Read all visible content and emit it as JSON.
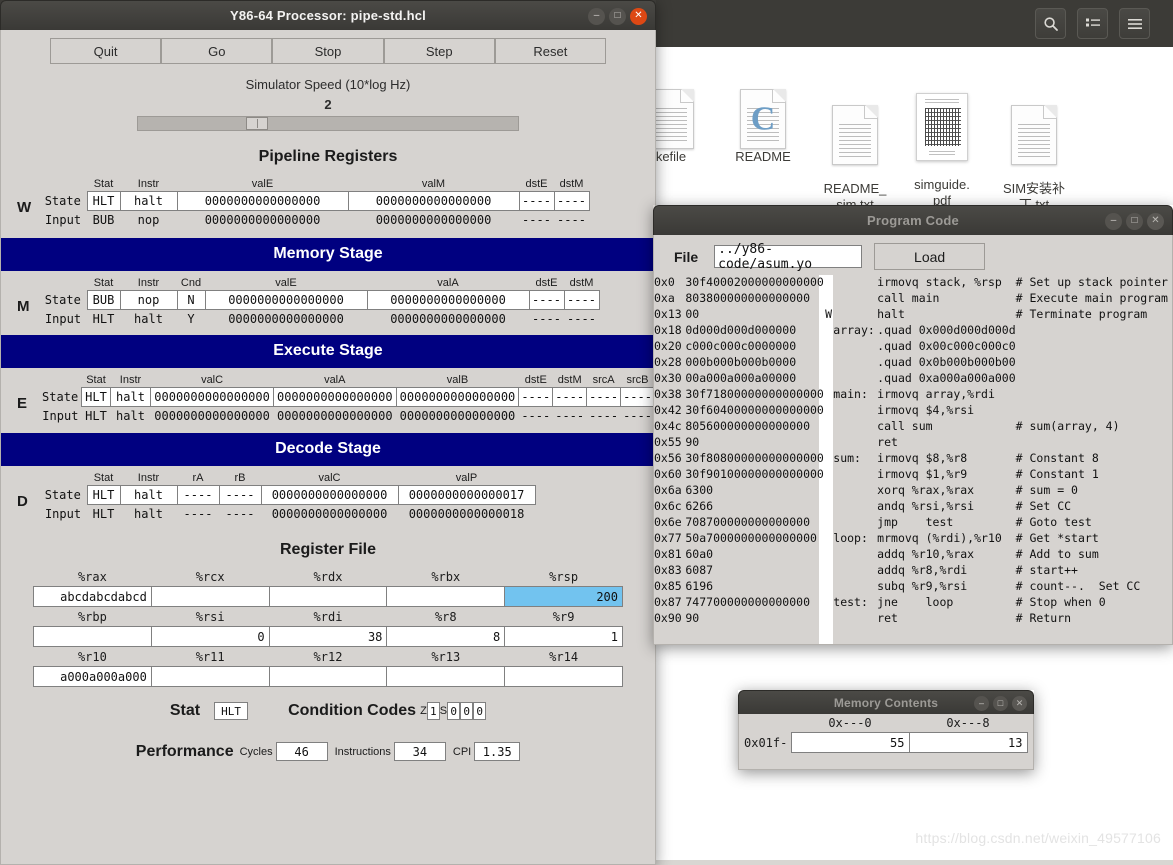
{
  "desktop": {
    "toolbar_icons": [
      "search-icon",
      "list-view-icon",
      "menu-icon"
    ],
    "files": [
      {
        "name": "kefile",
        "icon": "document-icon"
      },
      {
        "name": "README",
        "icon": "c-source-icon"
      },
      {
        "name": "README_\nsim.txt",
        "icon": "document-icon"
      },
      {
        "name": "simguide.\npdf",
        "icon": "pdf-icon"
      },
      {
        "name": "SIM安装补\n丁.txt",
        "icon": "document-icon"
      }
    ],
    "watermark": "https://blog.csdn.net/weixin_49577106"
  },
  "sim": {
    "title": "Y86-64 Processor: pipe-std.hcl",
    "buttons": [
      "Quit",
      "Go",
      "Stop",
      "Step",
      "Reset"
    ],
    "speed_label": "Simulator Speed (10*log Hz)",
    "speed_value": "2",
    "pipeline_title": "Pipeline Registers",
    "W": {
      "letter": "W",
      "headers": [
        "Stat",
        "Instr",
        "valE",
        "valM",
        "dstE",
        "dstM"
      ],
      "state_label": "State",
      "input_label": "Input",
      "state": [
        "HLT",
        "halt",
        "0000000000000000",
        "0000000000000000",
        "----",
        "----"
      ],
      "input": [
        "BUB",
        "nop",
        "0000000000000000",
        "0000000000000000",
        "----",
        "----"
      ]
    },
    "M": {
      "banner": "Memory Stage",
      "letter": "M",
      "headers": [
        "Stat",
        "Instr",
        "Cnd",
        "valE",
        "valA",
        "dstE",
        "dstM"
      ],
      "state_label": "State",
      "input_label": "Input",
      "state": [
        "BUB",
        "nop",
        "N",
        "0000000000000000",
        "0000000000000000",
        "----",
        "----"
      ],
      "input": [
        "HLT",
        "halt",
        "Y",
        "0000000000000000",
        "0000000000000000",
        "----",
        "----"
      ]
    },
    "E": {
      "banner": "Execute Stage",
      "letter": "E",
      "headers": [
        "Stat",
        "Instr",
        "valC",
        "valA",
        "valB",
        "dstE",
        "dstM",
        "srcA",
        "srcB"
      ],
      "state_label": "State",
      "input_label": "Input",
      "state": [
        "HLT",
        "halt",
        "0000000000000000",
        "0000000000000000",
        "0000000000000000",
        "----",
        "----",
        "----",
        "----"
      ],
      "input": [
        "HLT",
        "halt",
        "0000000000000000",
        "0000000000000000",
        "0000000000000000",
        "----",
        "----",
        "----",
        "----"
      ]
    },
    "D": {
      "banner": "Decode Stage",
      "letter": "D",
      "headers": [
        "Stat",
        "Instr",
        "rA",
        "rB",
        "valC",
        "valP"
      ],
      "state_label": "State",
      "input_label": "Input",
      "state": [
        "HLT",
        "halt",
        "----",
        "----",
        "0000000000000000",
        "0000000000000017"
      ],
      "input": [
        "HLT",
        "halt",
        "----",
        "----",
        "0000000000000000",
        "0000000000000018"
      ]
    },
    "regfile": {
      "title": "Register File",
      "rows": [
        {
          "names": [
            "%rax",
            "%rcx",
            "%rdx",
            "%rbx",
            "%rsp"
          ],
          "values": [
            "abcdabcdabcd",
            "",
            "",
            "",
            "200"
          ],
          "highlight": [
            false,
            false,
            false,
            false,
            true
          ]
        },
        {
          "names": [
            "%rbp",
            "%rsi",
            "%rdi",
            "%r8",
            "%r9"
          ],
          "values": [
            "",
            "0",
            "38",
            "8",
            "1"
          ],
          "highlight": [
            false,
            false,
            false,
            false,
            false
          ]
        },
        {
          "names": [
            "%r10",
            "%r11",
            "%r12",
            "%r13",
            "%r14"
          ],
          "values": [
            "a000a000a000",
            "",
            "",
            "",
            ""
          ],
          "highlight": [
            false,
            false,
            false,
            false,
            false
          ]
        }
      ]
    },
    "status": {
      "stat_label": "Stat",
      "stat_value": "HLT",
      "cc_label": "Condition Codes",
      "cc_z_label": "Z",
      "cc_z_value": "1",
      "cc_s_label": "S",
      "cc_s_value": "0",
      "cc_o_value_1": "0",
      "cc_o_value_2": "0"
    },
    "performance": {
      "label": "Performance",
      "cycles_label": "Cycles",
      "cycles_value": "46",
      "instructions_label": "Instructions",
      "instructions_value": "34",
      "cpi_label": "CPI",
      "cpi_value": "1.35"
    }
  },
  "code": {
    "title": "Program Code",
    "file_label": "File",
    "file_value": "../y86-code/asum.yo",
    "load_label": "Load",
    "lines": [
      {
        "addr": "0x0",
        "hex": "30f40002000000000000",
        "mark": "",
        "label": "",
        "instr": "irmovq stack, %rsp",
        "comment": "# Set up stack pointer"
      },
      {
        "addr": "0xa",
        "hex": "803800000000000000",
        "mark": "",
        "label": "",
        "instr": "call main",
        "comment": "# Execute main program"
      },
      {
        "addr": "0x13",
        "hex": "00",
        "mark": "W",
        "label": "",
        "instr": "halt",
        "comment": "# Terminate program"
      },
      {
        "addr": "0x18",
        "hex": "0d000d000d000000",
        "mark": "",
        "label": "array:",
        "instr": ".quad 0x000d000d000d",
        "comment": ""
      },
      {
        "addr": "0x20",
        "hex": "c000c000c0000000",
        "mark": "",
        "label": "",
        "instr": ".quad 0x00c000c000c0",
        "comment": ""
      },
      {
        "addr": "0x28",
        "hex": "000b000b000b0000",
        "mark": "",
        "label": "",
        "instr": ".quad 0x0b000b000b00",
        "comment": ""
      },
      {
        "addr": "0x30",
        "hex": "00a000a000a00000",
        "mark": "",
        "label": "",
        "instr": ".quad 0xa000a000a000",
        "comment": ""
      },
      {
        "addr": "0x38",
        "hex": "30f71800000000000000",
        "mark": "",
        "label": "main:",
        "instr": "irmovq array,%rdi",
        "comment": ""
      },
      {
        "addr": "0x42",
        "hex": "30f60400000000000000",
        "mark": "",
        "label": "",
        "instr": "irmovq $4,%rsi",
        "comment": ""
      },
      {
        "addr": "0x4c",
        "hex": "805600000000000000",
        "mark": "",
        "label": "",
        "instr": "call sum",
        "comment": "# sum(array, 4)"
      },
      {
        "addr": "0x55",
        "hex": "90",
        "mark": "",
        "label": "",
        "instr": "ret",
        "comment": ""
      },
      {
        "addr": "0x56",
        "hex": "30f80800000000000000",
        "mark": "",
        "label": "sum:",
        "instr": "irmovq $8,%r8",
        "comment": "# Constant 8"
      },
      {
        "addr": "0x60",
        "hex": "30f90100000000000000",
        "mark": "",
        "label": "",
        "instr": "irmovq $1,%r9",
        "comment": "# Constant 1"
      },
      {
        "addr": "0x6a",
        "hex": "6300",
        "mark": "",
        "label": "",
        "instr": "xorq %rax,%rax",
        "comment": "# sum = 0"
      },
      {
        "addr": "0x6c",
        "hex": "6266",
        "mark": "",
        "label": "",
        "instr": "andq %rsi,%rsi",
        "comment": "# Set CC"
      },
      {
        "addr": "0x6e",
        "hex": "708700000000000000",
        "mark": "",
        "label": "",
        "instr": "jmp    test",
        "comment": "# Goto test"
      },
      {
        "addr": "0x77",
        "hex": "50a7000000000000000",
        "mark": "",
        "label": "loop:",
        "instr": "mrmovq (%rdi),%r10",
        "comment": "# Get *start"
      },
      {
        "addr": "0x81",
        "hex": "60a0",
        "mark": "",
        "label": "",
        "instr": "addq %r10,%rax",
        "comment": "# Add to sum"
      },
      {
        "addr": "0x83",
        "hex": "6087",
        "mark": "",
        "label": "",
        "instr": "addq %r8,%rdi",
        "comment": "# start++"
      },
      {
        "addr": "0x85",
        "hex": "6196",
        "mark": "",
        "label": "",
        "instr": "subq %r9,%rsi",
        "comment": "# count--.  Set CC"
      },
      {
        "addr": "0x87",
        "hex": "747700000000000000",
        "mark": "",
        "label": "test:",
        "instr": "jne    loop",
        "comment": "# Stop when 0"
      },
      {
        "addr": "0x90",
        "hex": "90",
        "mark": "",
        "label": "",
        "instr": "ret",
        "comment": "# Return"
      }
    ]
  },
  "memory": {
    "title": "Memory Contents",
    "headers": [
      "0x---0",
      "0x---8"
    ],
    "rows": [
      {
        "addr": "0x01f-",
        "values": [
          "55",
          "13"
        ]
      }
    ]
  }
}
